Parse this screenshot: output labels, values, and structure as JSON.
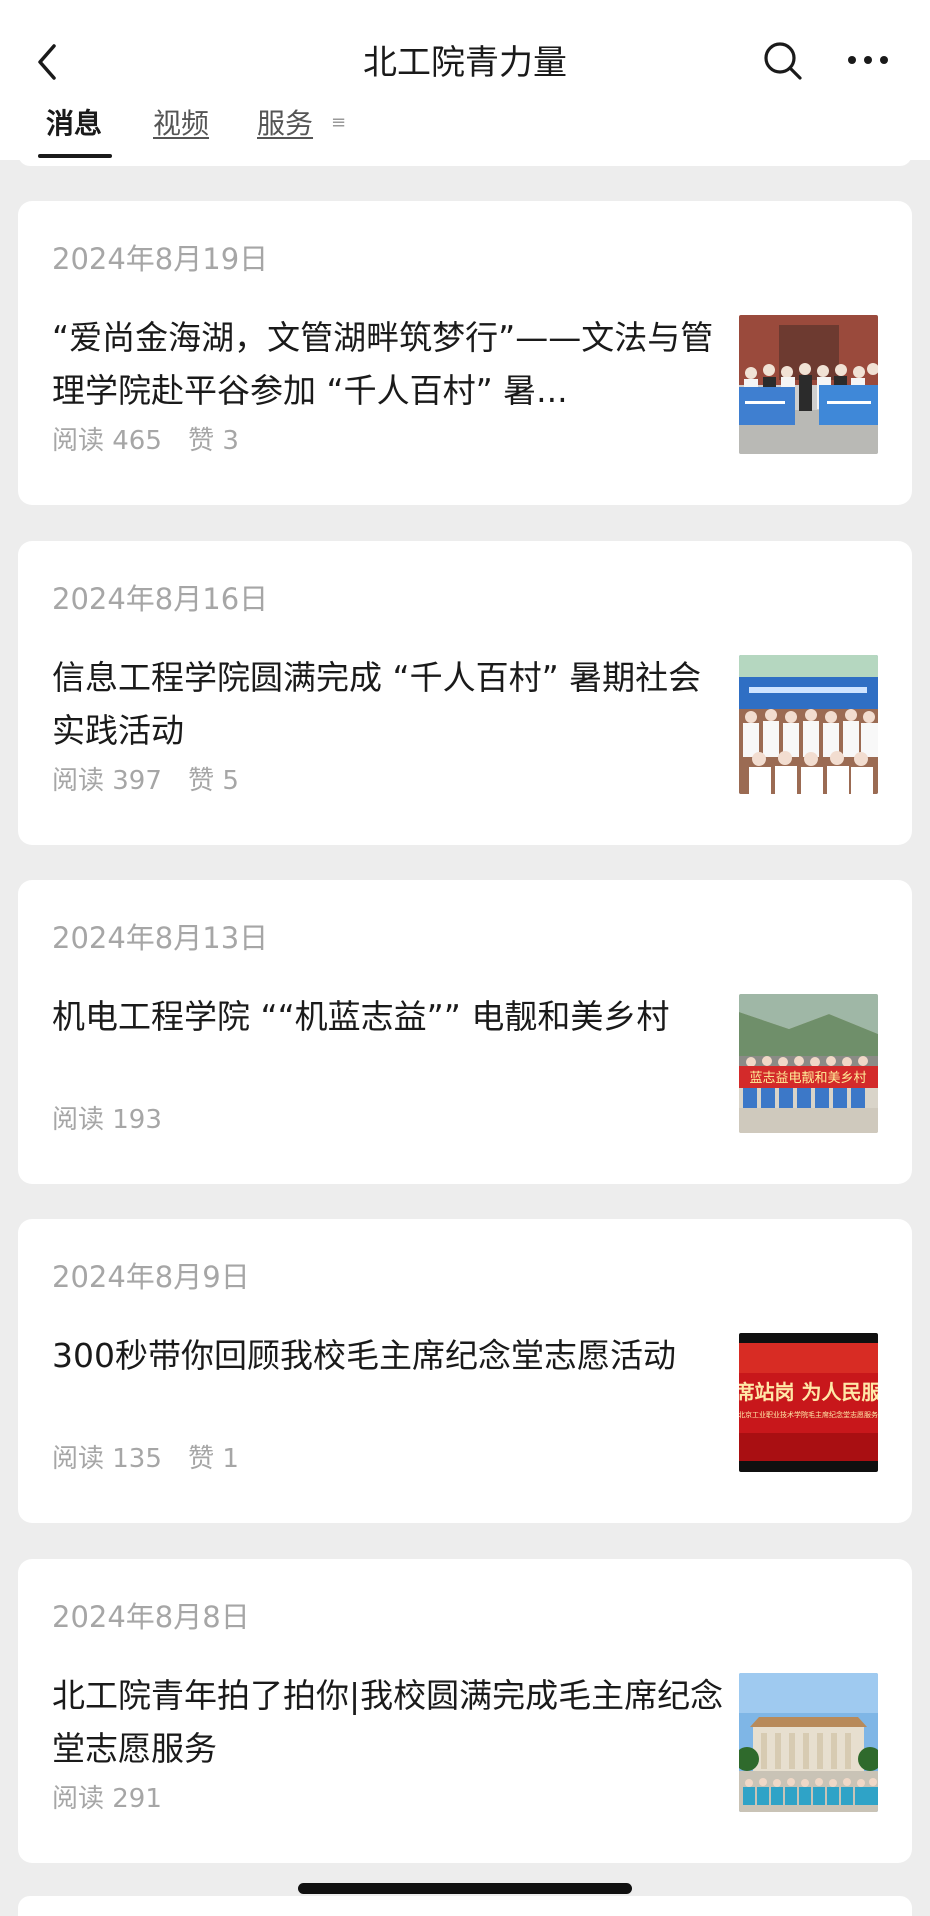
{
  "header": {
    "title": "北工院青力量",
    "back_icon": "chevron-left-icon",
    "search_icon": "search-icon",
    "more_icon": "more-horizontal-icon"
  },
  "tabs": [
    {
      "label": "消息",
      "active": true
    },
    {
      "label": "视频",
      "active": false
    },
    {
      "label": "服务",
      "active": false
    }
  ],
  "tab_menu_icon": "≡",
  "articles": [
    {
      "date": "2024年8月19日",
      "title": "“爱尚金海湖，文管湖畔筑梦行”——文法与管理学院赴平谷参加 “千人百村” 暑...",
      "reads": "阅读 465",
      "likes": "赞 3",
      "thumb": "group-photo-blue-banners"
    },
    {
      "date": "2024年8月16日",
      "title": "信息工程学院圆满完成 “千人百村” 暑期社会实践活动",
      "reads": "阅读 397",
      "likes": "赞 5",
      "thumb": "group-photo-outdoor"
    },
    {
      "date": "2024年8月13日",
      "title": "机电工程学院 ““机蓝志益”” 电靓和美乡村",
      "reads": "阅读 193",
      "likes": "",
      "thumb": "group-photo-red-banner-mountain"
    },
    {
      "date": "2024年8月9日",
      "title": "300秒带你回顾我校毛主席纪念堂志愿活动",
      "reads": "阅读 135",
      "likes": "赞 1",
      "thumb": "red-video-cover"
    },
    {
      "date": "2024年8月8日",
      "title": "北工院青年拍了拍你|我校圆满完成毛主席纪念堂志愿服务",
      "reads": "阅读 291",
      "likes": "",
      "thumb": "memorial-hall-group"
    }
  ],
  "thumb_text": {
    "a3": "蓝志益电靓和美乡村",
    "a4_line1": "席站岗 为人民服",
    "a4_line2": "北京工业职业技术学院毛主席纪念堂志愿服务"
  }
}
